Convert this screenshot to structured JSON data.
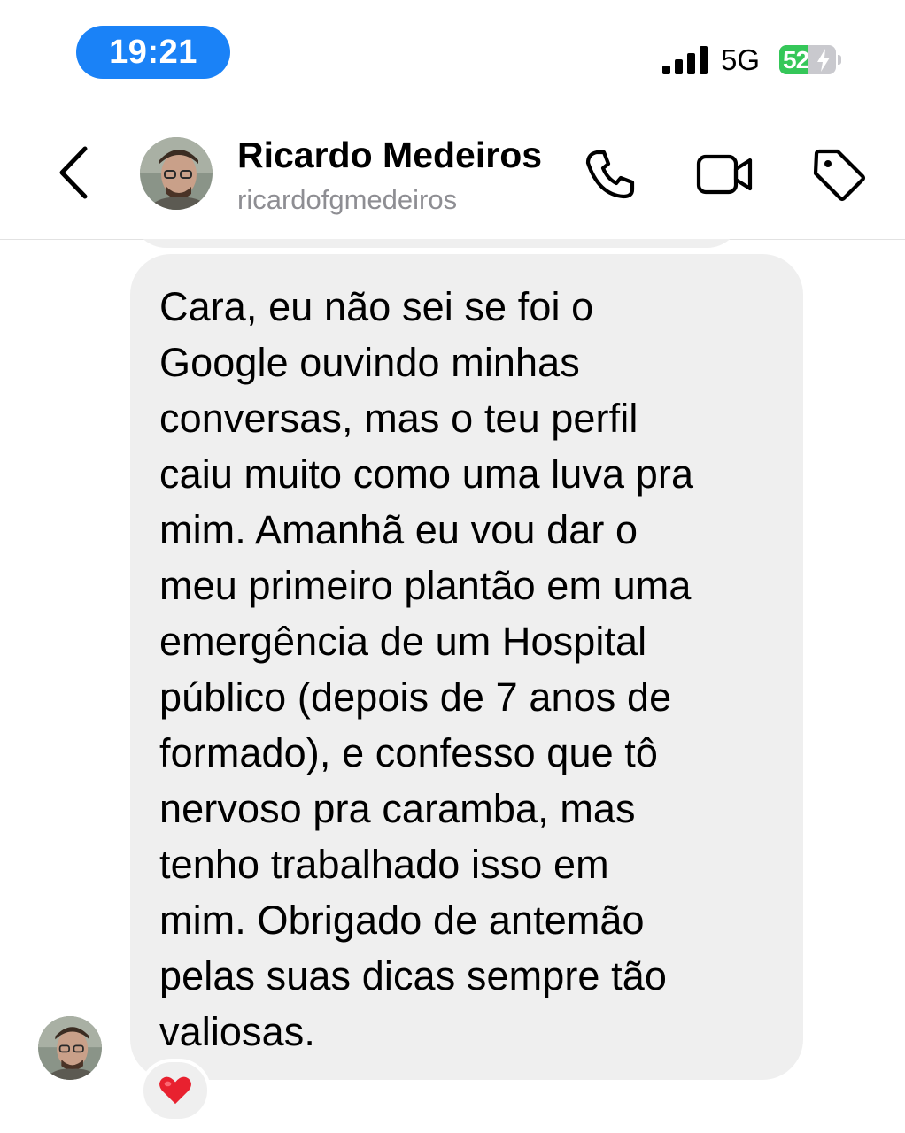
{
  "status_bar": {
    "time": "19:21",
    "network": "5G",
    "battery_percent": 52,
    "battery_label": "52"
  },
  "header": {
    "contact_name": "Ricardo Medeiros",
    "contact_handle": "ricardofgmedeiros",
    "icons": [
      "back-icon",
      "avatar",
      "phone-icon",
      "video-camera-icon",
      "tag-icon"
    ]
  },
  "conversation": {
    "message": {
      "lines": [
        "Cara, eu não sei se foi o",
        "Google ouvindo minhas",
        "conversas, mas o teu perfil",
        "caiu muito como uma luva pra",
        "mim. Amanhã eu vou dar o",
        "meu primeiro plantão em uma",
        "emergência de um Hospital",
        "público (depois de 7 anos de",
        "formado), e confesso que tô",
        "nervoso pra caramba, mas",
        "tenho trabalhado isso em",
        "mim. Obrigado de antemão",
        "pelas suas dicas sempre tão",
        "valiosas."
      ],
      "reaction": "❤️"
    }
  },
  "colors": {
    "time_pill": "#1a82f7",
    "bubble": "#efefef",
    "battery_fill": "#35c759",
    "handle_text": "#8e8e93"
  }
}
